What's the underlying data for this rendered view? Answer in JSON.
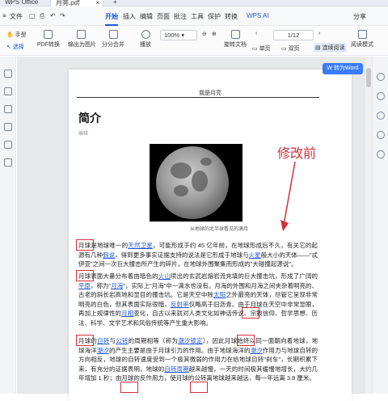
{
  "titlebar": {
    "tabs": [
      {
        "label": "WPS Office"
      },
      {
        "label": "月亮.pdf"
      }
    ]
  },
  "menu": {
    "file": "文件",
    "items": [
      "开始",
      "插入",
      "编辑",
      "页面",
      "批注",
      "工具",
      "保护",
      "转换"
    ],
    "wps_ai": "WPS AI",
    "share": "分享"
  },
  "ribbon": {
    "hand": "手型",
    "select": "选择",
    "pdf_convert": "PDF转换",
    "export_image": "输出为图片",
    "split_merge": "分分合并",
    "play": "播放",
    "zoom": "100%",
    "page_indicator": "1/12",
    "rotate": "旋转文档",
    "single_page": "单页",
    "double_page": "双页",
    "continuous": "连续阅读",
    "reading_mode": "阅读模式",
    "convert_word": "转为Word"
  },
  "document": {
    "running_head": "我是月亮",
    "heading": "简介",
    "subheading": "编辑",
    "image_caption": "从地球的北半球看见的满月",
    "annotation": "修改前",
    "paragraphs": [
      {
        "segments": [
          {
            "t": "月球",
            "red": true
          },
          {
            "t": "是地球唯一的"
          },
          {
            "t": "天然卫星",
            "link": true
          },
          {
            "t": "，可能形成于约 45 亿年前，在地球形成后不久，有关它的起源有几种"
          },
          {
            "t": "假说",
            "link": true
          },
          {
            "t": "，得到更多事实证据支持的说法是它形成于地球与"
          },
          {
            "t": "火星",
            "link": true
          },
          {
            "t": "般大小的天体——\"忒伊亚\"之间一次巨大撞击所产生的碎片，在地球外围聚集而形成的\"大碰撞起源说\"。"
          }
        ]
      },
      {
        "segments": [
          {
            "t": "月球",
            "red": true
          },
          {
            "t": "表面大量分布着由暗色的"
          },
          {
            "t": "火山",
            "link": true
          },
          {
            "t": "喷出的玄武岩熔岩流充填的巨大撞击坑，形成了广阔的"
          },
          {
            "t": "平原",
            "link": true
          },
          {
            "t": "，称为\""
          },
          {
            "t": "月海",
            "link": true
          },
          {
            "t": "\"，实际上\"月海\"中一滴水也没有。月海的外围和月海之间夹杂着明亮的、古老的斜长岩高地和显目的撞击坑。它是天空中除"
          },
          {
            "t": "太阳",
            "link": true
          },
          {
            "t": "之外最亮的天体，尽管它呈现非常明亮的白色，但其表面实际很暗，"
          },
          {
            "t": "反射率",
            "link": true
          },
          {
            "t": "仅略高于旧沥青。由于"
          },
          {
            "t": "月球",
            "red": true
          },
          {
            "t": "在天空中非常显眼，再加上规律性的"
          },
          {
            "t": "月相",
            "link": true
          },
          {
            "t": "变化，自古以来就对人类文化如神话传说、宗教信仰、哲学思想、历法、科学、文学艺术和风俗传统等产生重大影响。"
          }
        ]
      },
      {
        "segments": [
          {
            "t": "月球",
            "red": true
          },
          {
            "t": "的"
          },
          {
            "t": "自转",
            "link": true
          },
          {
            "t": "与"
          },
          {
            "t": "公转",
            "link": true
          },
          {
            "t": "的周期相等（称为"
          },
          {
            "t": "潮汐锁定",
            "link": true
          },
          {
            "t": "），因此"
          },
          {
            "t": "月球",
            "red": true
          },
          {
            "t": "始终以同一面朝向着地球，地球海洋"
          },
          {
            "t": "潮汐",
            "link": true
          },
          {
            "t": "的产生主要是由于"
          },
          {
            "t": "月球",
            "red": true
          },
          {
            "t": "引力的作用。由于地球海洋的"
          },
          {
            "t": "潮汐",
            "link": true
          },
          {
            "t": "作用力与地球自转的方向相反，地球的自转速度受到一个极其微弱的作用力在给地球自转\"刹车\"，长期积累下来，有充分的证据表明，地球的"
          },
          {
            "t": "自转",
            "link": true
          },
          {
            "t": "周期",
            "link": true
          },
          {
            "t": "越来越慢，一天的时间极其缓慢地增长，大约几年增加 1 秒；由"
          },
          {
            "t": "月球",
            "red": true
          },
          {
            "t": "的反作用力，使"
          },
          {
            "t": "月球",
            "red": true
          },
          {
            "t": "的公转离地球越来越远，每一年远离 3.8 厘米。"
          }
        ]
      }
    ]
  }
}
